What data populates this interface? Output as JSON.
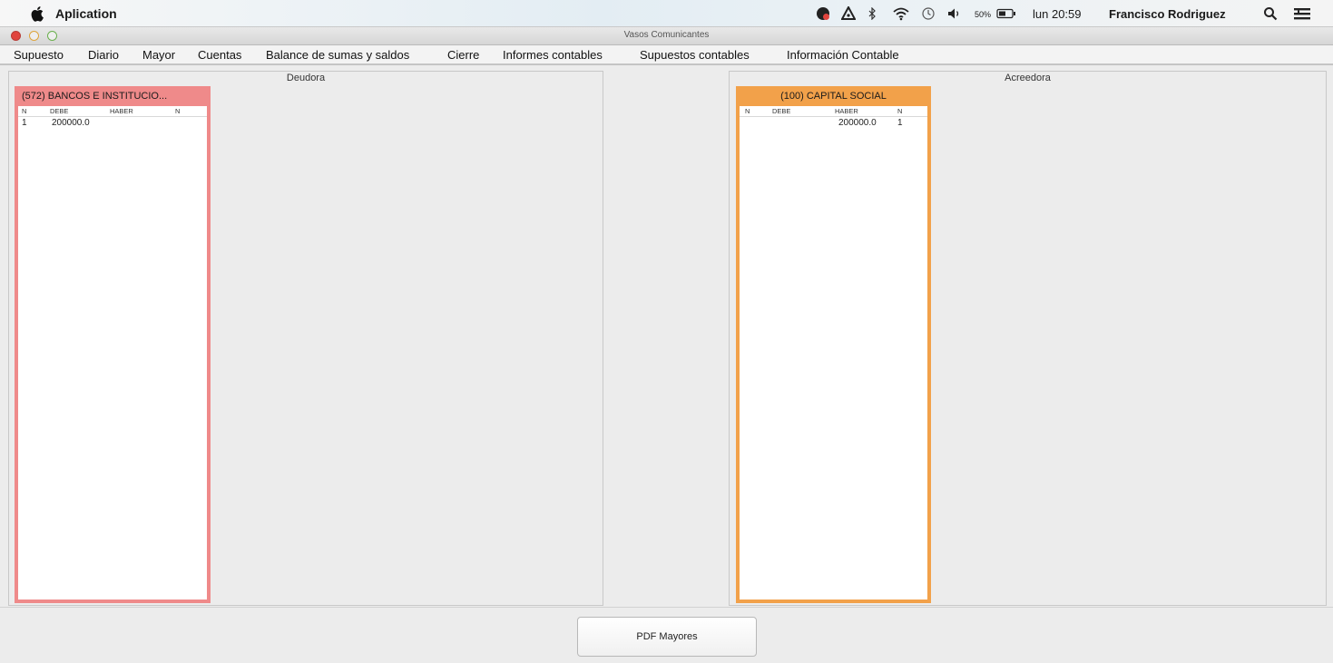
{
  "system_menubar": {
    "app_name": "Aplication",
    "battery_percent": "50%",
    "clock": "lun 20:59",
    "user_name": "Francisco Rodriguez",
    "icons": [
      "apple-icon",
      "record-icon",
      "drive-icon",
      "bluetooth-icon",
      "wifi-icon",
      "time-machine-icon",
      "volume-icon",
      "battery-icon",
      "search-icon",
      "list-icon"
    ]
  },
  "window": {
    "title": "Vasos Comunicantes"
  },
  "app_menu": {
    "items": [
      "Supuesto",
      "Diario",
      "Mayor",
      "Cuentas",
      "Balance de sumas y saldos",
      "Cierre",
      "Informes contables",
      "Supuestos contables",
      "Información Contable"
    ]
  },
  "panels": {
    "deudora": {
      "title": "Deudora",
      "accounts": [
        {
          "header": "(572) BANCOS E INSTITUCIO...",
          "color": "#ef8a8a",
          "columns": [
            "N",
            "DEBE",
            "HABER",
            "N"
          ],
          "rows": [
            {
              "n_left": "1",
              "debe": "200000.0",
              "haber": "",
              "n_right": ""
            }
          ]
        }
      ]
    },
    "acreedora": {
      "title": "Acreedora",
      "accounts": [
        {
          "header": "(100) CAPITAL SOCIAL",
          "color": "#f2a14a",
          "columns": [
            "N",
            "DEBE",
            "HABER",
            "N"
          ],
          "rows": [
            {
              "n_left": "",
              "debe": "",
              "haber": "200000.0",
              "n_right": "1"
            }
          ]
        }
      ]
    }
  },
  "footer": {
    "pdf_button_label": "PDF Mayores"
  }
}
